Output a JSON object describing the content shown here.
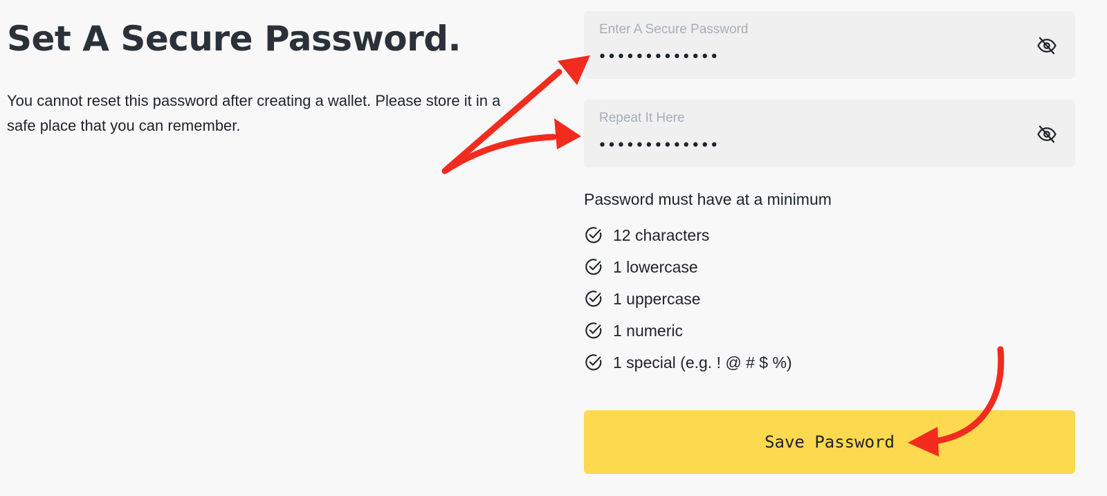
{
  "header": {
    "title": "Set A Secure Password.",
    "description": "You cannot reset this password after creating a wallet. Please store it in a safe place that you can remember."
  },
  "form": {
    "password": {
      "label": "Enter A Secure Password",
      "value": "•••••••••••••"
    },
    "repeat": {
      "label": "Repeat It Here",
      "value": "•••••••••••••"
    }
  },
  "requirements": {
    "title": "Password must have at a minimum",
    "items": [
      {
        "label": "12 characters",
        "icon": "check-circle-icon"
      },
      {
        "label": "1 lowercase",
        "icon": "check-circle-icon"
      },
      {
        "label": "1 uppercase",
        "icon": "check-circle-icon"
      },
      {
        "label": "1 numeric",
        "icon": "check-circle-icon"
      },
      {
        "label": "1 special (e.g. ! @ # $ %)",
        "icon": "check-circle-icon"
      }
    ]
  },
  "actions": {
    "save_label": "Save Password"
  },
  "icons": {
    "toggle_visibility": "eye-off-icon",
    "annotation": "arrow-icon"
  },
  "colors": {
    "button": "#fcd94f",
    "field_bg": "#f0f0f0",
    "annotation_arrow": "#f22b1f",
    "text": "#1e2329"
  }
}
